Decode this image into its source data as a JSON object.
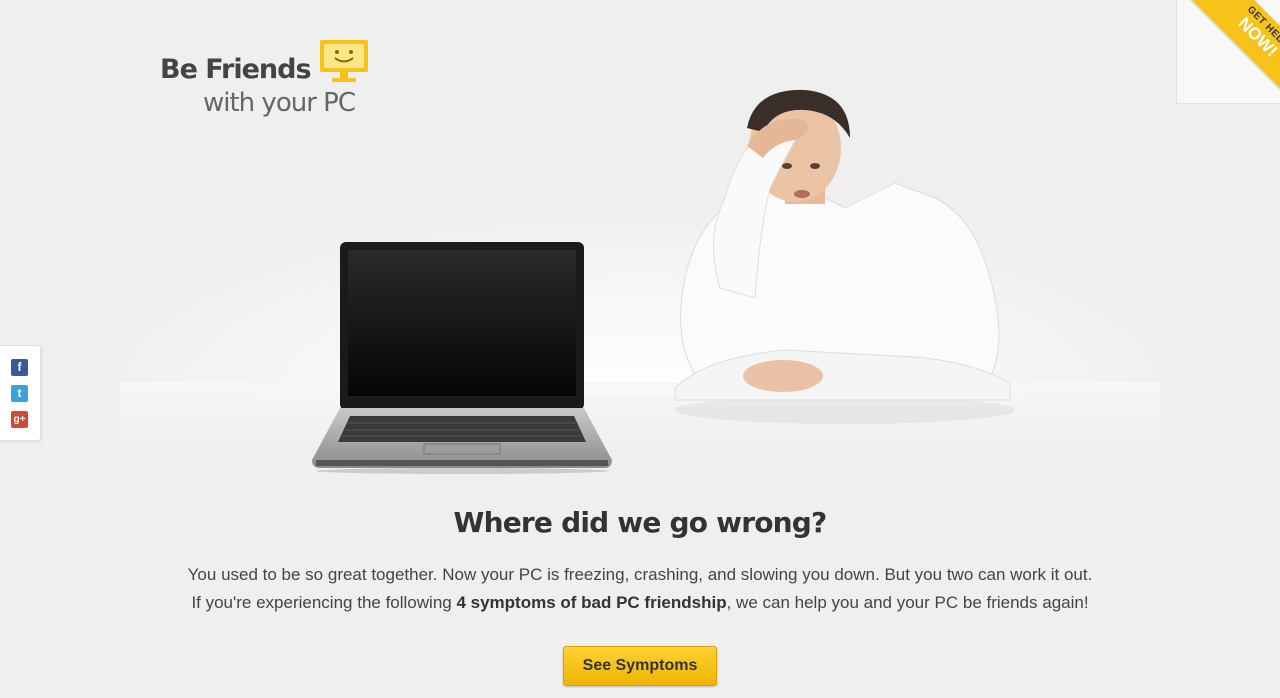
{
  "logo": {
    "line1": "Be Friends",
    "line2": "with your PC",
    "icon": "smiley-monitor-icon",
    "accent": "#f7c31a"
  },
  "corner": {
    "small": "GET HELP",
    "big": "NOW!",
    "color": "#f7c31a"
  },
  "social": [
    {
      "name": "facebook",
      "label": "f",
      "color": "#3b5998"
    },
    {
      "name": "twitter",
      "label": "t",
      "color": "#3aa3d8"
    },
    {
      "name": "google-plus",
      "label": "g+",
      "color": "#cf4a35"
    }
  ],
  "hero": {
    "headline": "Where did we go wrong?",
    "line1": "You used to be so great together. Now your PC is freezing, crashing, and slowing you down. But you two can work it out.",
    "line2_pre": "If you're experiencing the following ",
    "line2_bold": "4 symptoms of bad PC friendship",
    "line2_post": ", we can help you and your PC be friends again!"
  },
  "cta": {
    "label": "See Symptoms",
    "color": "#f7c31a"
  }
}
